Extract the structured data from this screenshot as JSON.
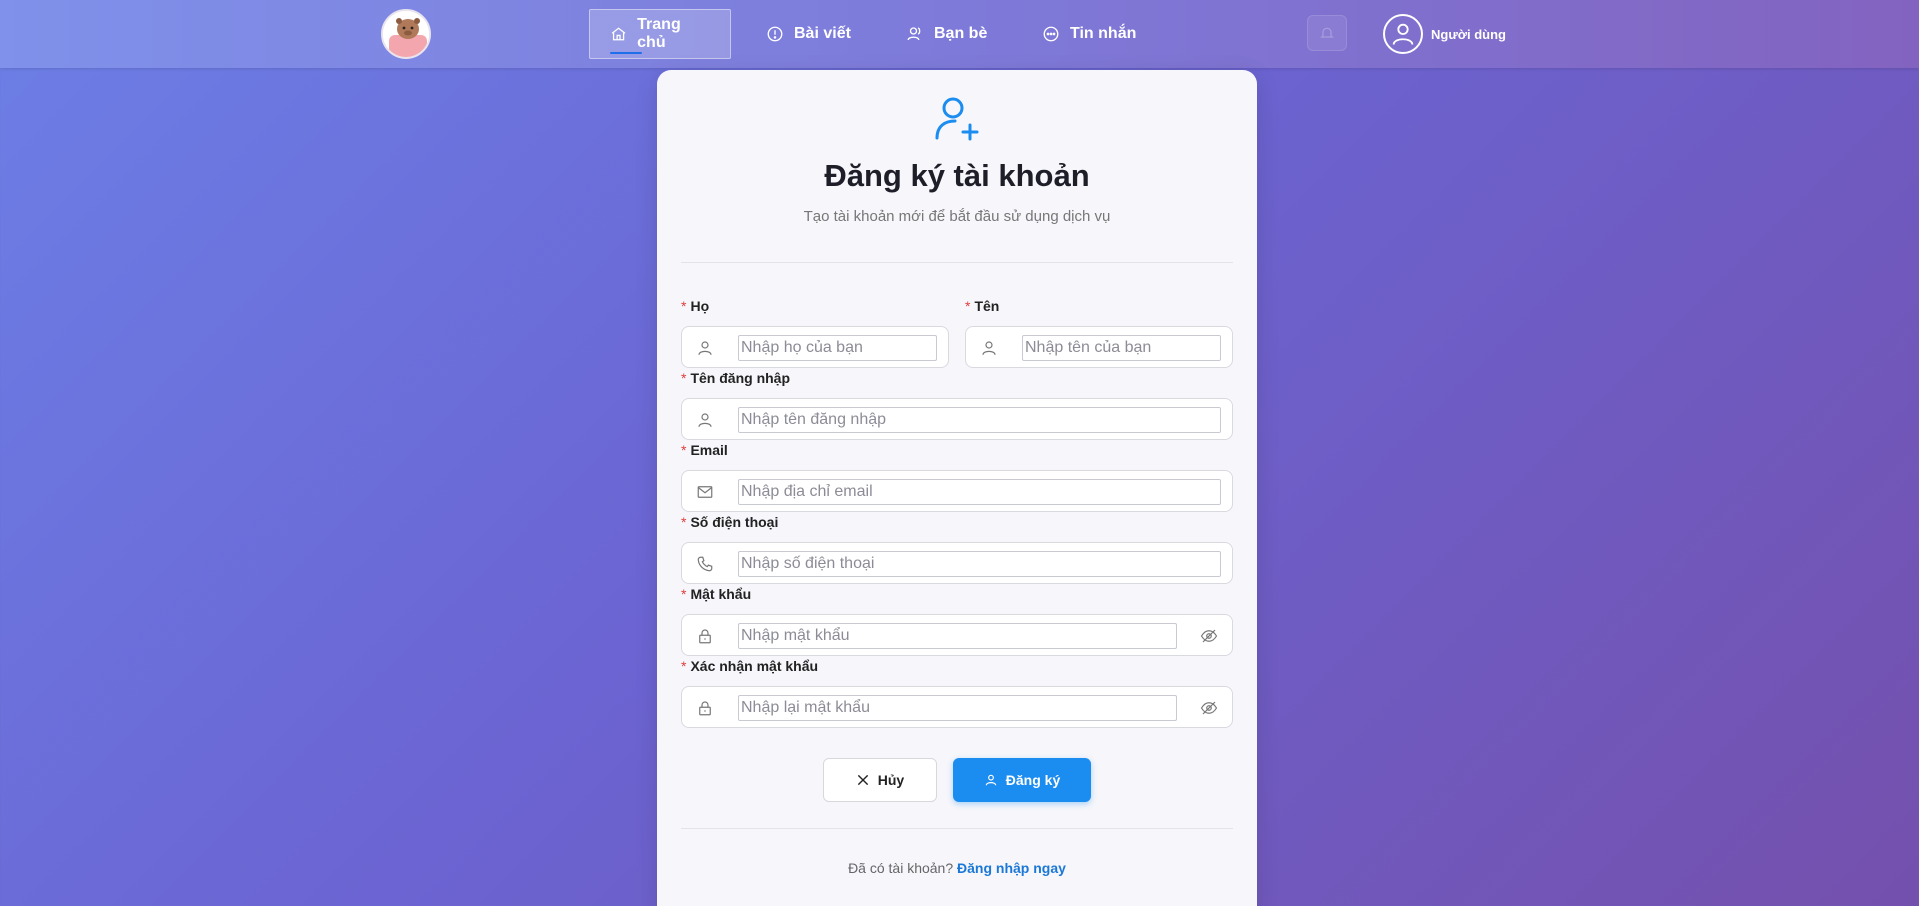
{
  "header": {
    "nav": [
      {
        "label": "Trang chủ",
        "icon": "home-icon",
        "active": true
      },
      {
        "label": "Bài viết",
        "icon": "info-icon",
        "active": false
      },
      {
        "label": "Bạn bè",
        "icon": "users-icon",
        "active": false
      },
      {
        "label": "Tin nhắn",
        "icon": "chat-icon",
        "active": false
      }
    ],
    "user_label": "Người dùng"
  },
  "form": {
    "title": "Đăng ký tài khoản",
    "subtitle": "Tạo tài khoản mới để bắt đầu sử dụng dịch vụ",
    "fields": {
      "last_name": {
        "label": "Họ",
        "placeholder": "Nhập họ của bạn",
        "value": ""
      },
      "first_name": {
        "label": "Tên",
        "placeholder": "Nhập tên của bạn",
        "value": ""
      },
      "username": {
        "label": "Tên đăng nhập",
        "placeholder": "Nhập tên đăng nhập",
        "value": ""
      },
      "email": {
        "label": "Email",
        "placeholder": "Nhập địa chỉ email",
        "value": ""
      },
      "phone": {
        "label": "Số điện thoại",
        "placeholder": "Nhập số điện thoại",
        "value": ""
      },
      "password": {
        "label": "Mật khẩu",
        "placeholder": "Nhập mật khẩu",
        "value": ""
      },
      "confirm_password": {
        "label": "Xác nhận mật khẩu",
        "placeholder": "Nhập lại mật khẩu",
        "value": ""
      }
    },
    "required_mark": "*",
    "cancel_label": "Hủy",
    "submit_label": "Đăng ký",
    "footer_text": "Đã có tài khoản?",
    "footer_link": "Đăng nhập ngay"
  },
  "colors": {
    "primary": "#1b8cf0",
    "required": "#e23d3d"
  }
}
